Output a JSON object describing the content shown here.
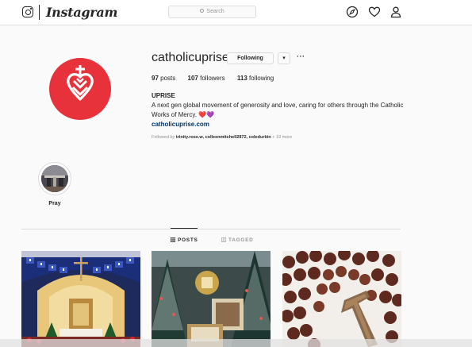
{
  "nav": {
    "wordmark": "Instagram",
    "search_placeholder": "Search",
    "icons": [
      "instagram-glyph-icon",
      "compass-icon",
      "heart-icon",
      "person-icon"
    ]
  },
  "profile": {
    "username": "catholicuprise",
    "following_button": "Following",
    "dropdown_glyph": "▾",
    "more_glyph": "···",
    "posts_count": "97",
    "posts_label": "posts",
    "followers_count": "107",
    "followers_label": "followers",
    "following_count": "113",
    "following_label": "following",
    "name": "UPRISE",
    "bio": "A next gen global movement of generosity and love, caring for others through the Catholic Works of Mercy.",
    "bio_emoji": "❤️💜",
    "link": "catholicuprise.com",
    "followed_by_prefix": "Followed by",
    "followed_by_users": "trinity.rose.w, colleenmitchell2872, coledurbin",
    "followed_by_more": "+ 19 more"
  },
  "highlights": [
    {
      "label": "Pray"
    }
  ],
  "tabs": [
    {
      "label": "POSTS",
      "active": true
    },
    {
      "label": "TAGGED",
      "active": false
    }
  ],
  "posts": [
    {
      "subject": "church-altar-crucifix"
    },
    {
      "subject": "christmas-trees-nativity"
    },
    {
      "subject": "wooden-rosary"
    }
  ],
  "colors": {
    "brand_red": "#e7313b",
    "link_blue": "#003569",
    "border": "#dbdbdb",
    "background": "#fafafa"
  }
}
